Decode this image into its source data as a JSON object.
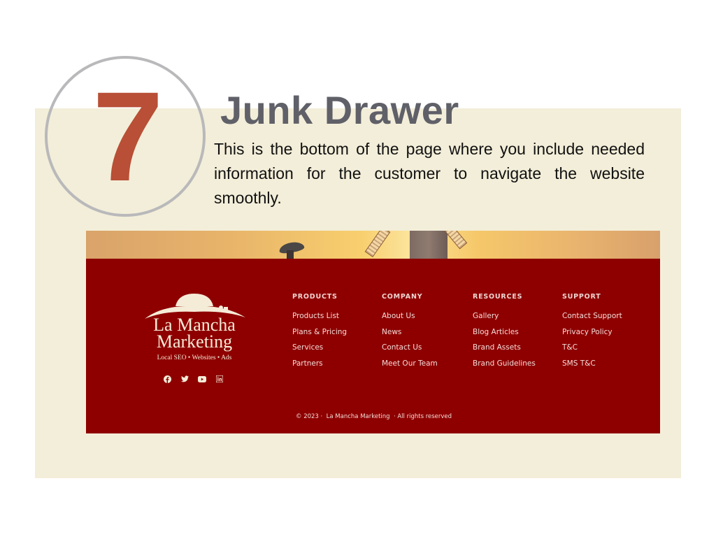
{
  "slide": {
    "step_number": "7",
    "title": "Junk Drawer",
    "description": "This is the bottom of the page where you include needed information for the customer to navigate the website smoothly.",
    "colors": {
      "panel_background": "#f3eed9",
      "number": "#b84f36",
      "title": "#5f6068",
      "circle": "#b9b9bb",
      "footer_background": "#8e0000"
    }
  },
  "footer": {
    "hero_image": "windmill-sunset-with-hat",
    "logo": {
      "line1": "La Mancha",
      "line2": "Marketing",
      "tagline": "Local SEO • Websites • Ads"
    },
    "social_icons": [
      "facebook-icon",
      "twitter-icon",
      "youtube-icon",
      "linkedin-icon"
    ],
    "columns": [
      {
        "heading": "PRODUCTS",
        "links": [
          "Products List",
          "Plans & Pricing",
          "Services",
          "Partners"
        ]
      },
      {
        "heading": "COMPANY",
        "links": [
          "About Us",
          "News",
          "Contact Us",
          "Meet Our Team"
        ]
      },
      {
        "heading": "RESOURCES",
        "links": [
          "Gallery",
          "Blog Articles",
          "Brand Assets",
          "Brand Guidelines"
        ]
      },
      {
        "heading": "SUPPORT",
        "links": [
          "Contact Support",
          "Privacy Policy",
          "T&C",
          "SMS T&C"
        ]
      }
    ],
    "copyright": "© 2023 ·  La Mancha Marketing  · All rights reserved"
  }
}
